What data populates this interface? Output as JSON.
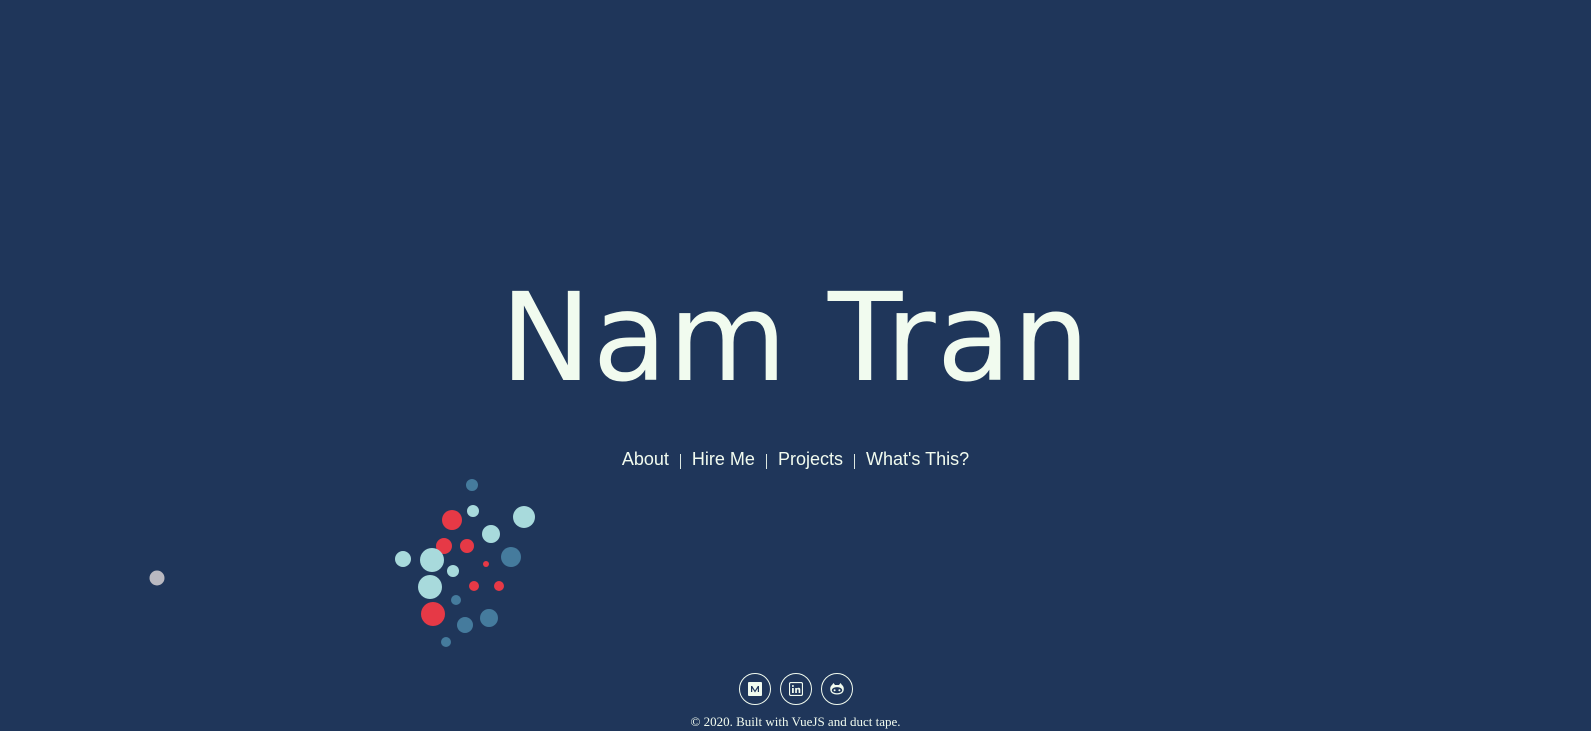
{
  "hero": {
    "name": "Nam Tran"
  },
  "nav": {
    "items": [
      {
        "label": "About"
      },
      {
        "label": "Hire Me"
      },
      {
        "label": "Projects"
      },
      {
        "label": "What's This?"
      }
    ]
  },
  "social": {
    "icons": [
      "medium-icon",
      "linkedin-icon",
      "github-icon"
    ]
  },
  "footer": {
    "text": "© 2020. Built with VueJS and duct tape."
  },
  "colors": {
    "background": "#1f365a",
    "text": "#f1fbef",
    "particle_red": "#e63946",
    "particle_light": "#a8dadc",
    "particle_blue": "#457b9d",
    "particle_grey": "#b9b9c1"
  }
}
